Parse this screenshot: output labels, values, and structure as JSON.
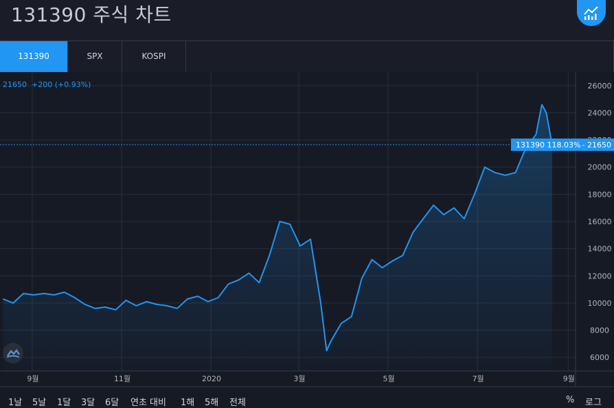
{
  "title": "131390 주식 차트",
  "tabs": [
    {
      "label": "131390",
      "active": true
    },
    {
      "label": "SPX",
      "active": false
    },
    {
      "label": "KOSPI",
      "active": false
    }
  ],
  "legend": {
    "symbol": "21650",
    "change": "+200 (+0.93%)"
  },
  "price_label": {
    "symbol": "131390",
    "percent": "118.03%",
    "value": "21650"
  },
  "ranges": [
    "1날",
    "5날",
    "1달",
    "3달",
    "6달",
    "연초 대비",
    "1해",
    "5해",
    "전체"
  ],
  "right_controls": [
    "%",
    "로그"
  ],
  "colors": {
    "line": "#2196f3",
    "accent": "#2196f3",
    "background": "#161a25"
  },
  "chart_data": {
    "type": "area",
    "y_ticks": [
      6000,
      8000,
      10000,
      12000,
      14000,
      16000,
      18000,
      20000,
      22000,
      24000,
      26000
    ],
    "y_tick_labels": [
      "6000",
      "8000",
      "10000",
      "12000",
      "14000",
      "16000",
      "18000",
      "20000",
      "22000",
      "24000",
      "26000"
    ],
    "ylim": [
      5000,
      27000
    ],
    "x_ticks": [
      {
        "label": "9월",
        "date": "2019-09-01"
      },
      {
        "label": "11월",
        "date": "2019-11-01"
      },
      {
        "label": "2020",
        "date": "2020-01-01"
      },
      {
        "label": "3월",
        "date": "2020-03-01"
      },
      {
        "label": "5월",
        "date": "2020-05-01"
      },
      {
        "label": "7월",
        "date": "2020-07-01"
      },
      {
        "label": "9월",
        "date": "2020-09-01"
      }
    ],
    "xlim": [
      "2019-08-10",
      "2020-09-06"
    ],
    "last_value": 21650,
    "series": [
      {
        "values": [
          [
            "2019-08-12",
            10300
          ],
          [
            "2019-08-19",
            10000
          ],
          [
            "2019-08-26",
            10700
          ],
          [
            "2019-09-02",
            10600
          ],
          [
            "2019-09-09",
            10700
          ],
          [
            "2019-09-16",
            10600
          ],
          [
            "2019-09-23",
            10800
          ],
          [
            "2019-09-30",
            10400
          ],
          [
            "2019-10-07",
            9900
          ],
          [
            "2019-10-14",
            9600
          ],
          [
            "2019-10-21",
            9700
          ],
          [
            "2019-10-28",
            9500
          ],
          [
            "2019-11-04",
            10200
          ],
          [
            "2019-11-11",
            9800
          ],
          [
            "2019-11-18",
            10100
          ],
          [
            "2019-11-25",
            9900
          ],
          [
            "2019-12-02",
            9800
          ],
          [
            "2019-12-09",
            9600
          ],
          [
            "2019-12-16",
            10300
          ],
          [
            "2019-12-23",
            10500
          ],
          [
            "2019-12-30",
            10100
          ],
          [
            "2020-01-06",
            10400
          ],
          [
            "2020-01-13",
            11400
          ],
          [
            "2020-01-20",
            11700
          ],
          [
            "2020-01-27",
            12200
          ],
          [
            "2020-02-03",
            11500
          ],
          [
            "2020-02-10",
            13500
          ],
          [
            "2020-02-17",
            16000
          ],
          [
            "2020-02-24",
            15800
          ],
          [
            "2020-03-02",
            14200
          ],
          [
            "2020-03-09",
            14700
          ],
          [
            "2020-03-16",
            10000
          ],
          [
            "2020-03-20",
            6500
          ],
          [
            "2020-03-23",
            7200
          ],
          [
            "2020-03-30",
            8500
          ],
          [
            "2020-04-06",
            9000
          ],
          [
            "2020-04-13",
            11800
          ],
          [
            "2020-04-20",
            13200
          ],
          [
            "2020-04-27",
            12600
          ],
          [
            "2020-05-04",
            13100
          ],
          [
            "2020-05-11",
            13500
          ],
          [
            "2020-05-18",
            15200
          ],
          [
            "2020-05-25",
            16200
          ],
          [
            "2020-06-01",
            17200
          ],
          [
            "2020-06-08",
            16500
          ],
          [
            "2020-06-15",
            17000
          ],
          [
            "2020-06-22",
            16200
          ],
          [
            "2020-06-29",
            18000
          ],
          [
            "2020-07-06",
            20000
          ],
          [
            "2020-07-13",
            19600
          ],
          [
            "2020-07-20",
            19400
          ],
          [
            "2020-07-27",
            19600
          ],
          [
            "2020-08-03",
            21400
          ],
          [
            "2020-08-10",
            22400
          ],
          [
            "2020-08-14",
            24600
          ],
          [
            "2020-08-17",
            24000
          ],
          [
            "2020-08-21",
            21650
          ]
        ]
      }
    ]
  }
}
